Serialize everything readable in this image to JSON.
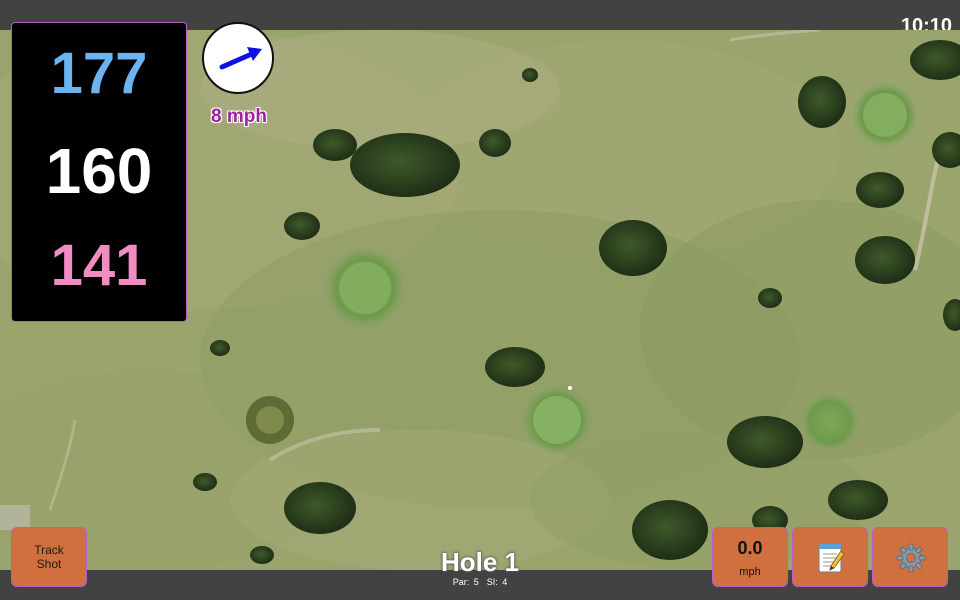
{
  "status_bar": {
    "time": "10:10"
  },
  "distances": {
    "back": "177",
    "center": "160",
    "front": "141",
    "colors": {
      "back": "#6cb4f0",
      "center": "#ffffff",
      "front": "#f48cc4"
    }
  },
  "wind": {
    "speed_label": "8 mph",
    "arrow_color": "#1010e0",
    "label_color": "#a020a0",
    "icon": "wind-direction-arrow"
  },
  "buttons": {
    "track_shot": "Track\nShot",
    "wind_speed_value": "0.0",
    "wind_speed_unit": "mph",
    "scorecard_icon": "notepad-icon",
    "settings_icon": "gear-icon",
    "color": "#d0703f"
  },
  "hole": {
    "title": "Hole 1",
    "par": "Par: 5",
    "stroke_index": "SI: 4"
  }
}
